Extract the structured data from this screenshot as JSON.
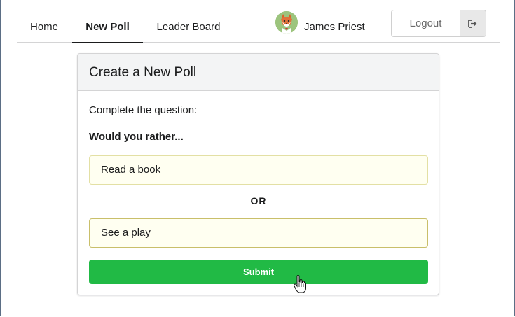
{
  "nav": {
    "items": [
      {
        "label": "Home"
      },
      {
        "label": "New Poll"
      },
      {
        "label": "Leader Board"
      }
    ],
    "active_item": "New Poll",
    "user": {
      "name": "James Priest",
      "avatar_icon": "fox-avatar-icon"
    },
    "logout": {
      "label": "Logout",
      "icon": "sign-out-icon"
    }
  },
  "card": {
    "title": "Create a New Poll",
    "prompt": "Complete the question:",
    "question": "Would you rather...",
    "option_one_value": "Read a book",
    "divider_label": "OR",
    "option_two_value": "See a play",
    "submit_label": "Submit"
  },
  "colors": {
    "accent_green": "#21ba45",
    "option_bg": "#fffff1",
    "option_border": "#e3e0a4",
    "header_bg": "#f3f4f5"
  }
}
